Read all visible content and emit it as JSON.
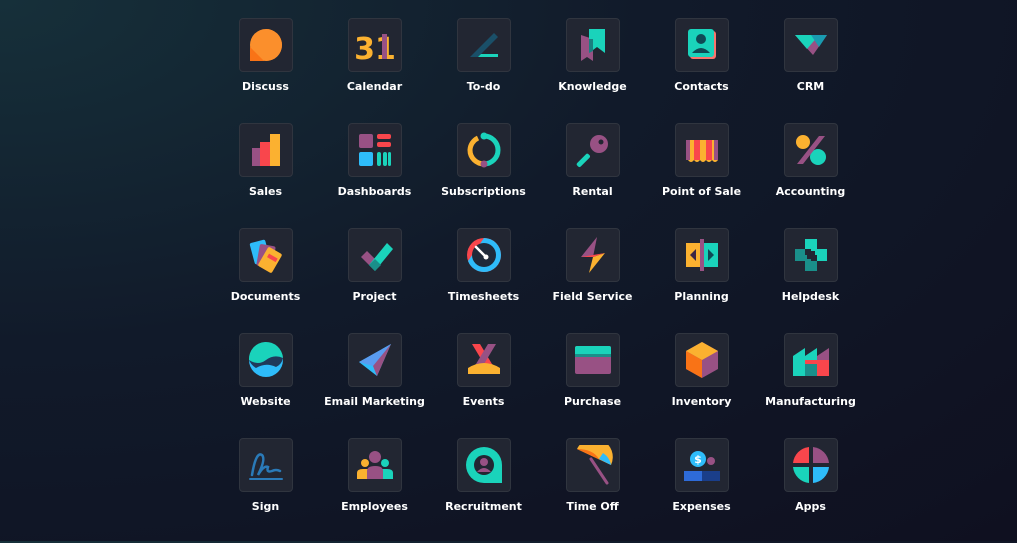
{
  "apps": [
    {
      "label": "Discuss",
      "icon": "discuss-icon"
    },
    {
      "label": "Calendar",
      "icon": "calendar-icon",
      "icon_text": "31"
    },
    {
      "label": "To-do",
      "icon": "todo-icon"
    },
    {
      "label": "Knowledge",
      "icon": "knowledge-icon"
    },
    {
      "label": "Contacts",
      "icon": "contacts-icon"
    },
    {
      "label": "CRM",
      "icon": "crm-icon"
    },
    {
      "label": "Sales",
      "icon": "sales-icon"
    },
    {
      "label": "Dashboards",
      "icon": "dashboards-icon"
    },
    {
      "label": "Subscriptions",
      "icon": "subscriptions-icon"
    },
    {
      "label": "Rental",
      "icon": "rental-icon"
    },
    {
      "label": "Point of Sale",
      "icon": "point-of-sale-icon"
    },
    {
      "label": "Accounting",
      "icon": "accounting-icon"
    },
    {
      "label": "Documents",
      "icon": "documents-icon"
    },
    {
      "label": "Project",
      "icon": "project-icon"
    },
    {
      "label": "Timesheets",
      "icon": "timesheets-icon"
    },
    {
      "label": "Field Service",
      "icon": "field-service-icon"
    },
    {
      "label": "Planning",
      "icon": "planning-icon"
    },
    {
      "label": "Helpdesk",
      "icon": "helpdesk-icon"
    },
    {
      "label": "Website",
      "icon": "website-icon"
    },
    {
      "label": "Email Marketing",
      "icon": "email-marketing-icon"
    },
    {
      "label": "Events",
      "icon": "events-icon"
    },
    {
      "label": "Purchase",
      "icon": "purchase-icon"
    },
    {
      "label": "Inventory",
      "icon": "inventory-icon"
    },
    {
      "label": "Manufacturing",
      "icon": "manufacturing-icon"
    },
    {
      "label": "Sign",
      "icon": "sign-icon"
    },
    {
      "label": "Employees",
      "icon": "employees-icon"
    },
    {
      "label": "Recruitment",
      "icon": "recruitment-icon"
    },
    {
      "label": "Time Off",
      "icon": "time-off-icon"
    },
    {
      "label": "Expenses",
      "icon": "expenses-icon",
      "icon_text": "$"
    },
    {
      "label": "Apps",
      "icon": "apps-icon"
    }
  ],
  "colors": {
    "background": "#111a2a",
    "tile": "#222632",
    "teal": "#1ad3bb",
    "orange": "#fbb130",
    "red": "#f9464c",
    "purple": "#985184",
    "blue": "#2ebcfa"
  }
}
